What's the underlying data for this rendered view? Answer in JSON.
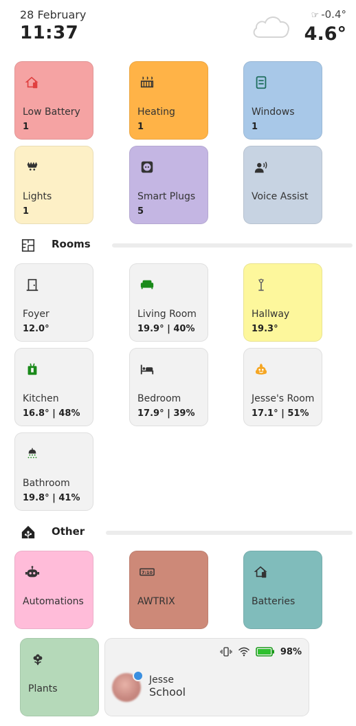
{
  "header": {
    "date": "28 February",
    "time": "11:37",
    "weather_icon": "cloud-icon",
    "temp_low": "-0.4°",
    "temp_current": "4.6°"
  },
  "status_tiles": [
    {
      "label": "Low Battery",
      "value": "1",
      "icon": "battery-alert-icon",
      "color": "#f5a3a3"
    },
    {
      "label": "Heating",
      "value": "1",
      "icon": "radiator-icon",
      "color": "#ffb347"
    },
    {
      "label": "Windows",
      "value": "1",
      "icon": "window-icon",
      "color": "#a8c8e8"
    },
    {
      "label": "Lights",
      "value": "1",
      "icon": "ceiling-light-icon",
      "color": "#fdf0c6"
    },
    {
      "label": "Smart Plugs",
      "value": "5",
      "icon": "power-socket-icon",
      "color": "#c4b6e3"
    },
    {
      "label": "Voice Assist",
      "value": "",
      "icon": "voice-assist-icon",
      "color": "#c7d3e2"
    }
  ],
  "rooms_section": {
    "title": "Rooms",
    "icon": "floor-plan-icon"
  },
  "rooms": [
    {
      "label": "Foyer",
      "value": "12.0°",
      "icon": "door-icon",
      "color": "#f2f2f2"
    },
    {
      "label": "Living Room",
      "value": "19.9° | 40%",
      "icon": "sofa-icon",
      "color": "#f2f2f2"
    },
    {
      "label": "Hallway",
      "value": "19.3°",
      "icon": "floor-lamp-icon",
      "color": "#fdf79c"
    },
    {
      "label": "Kitchen",
      "value": "16.8° | 48%",
      "icon": "fridge-icon",
      "color": "#f2f2f2"
    },
    {
      "label": "Bedroom",
      "value": "17.9° | 39%",
      "icon": "bed-icon",
      "color": "#f2f2f2"
    },
    {
      "label": "Jesse's Room",
      "value": "17.1° | 51%",
      "icon": "emoji-icon",
      "color": "#f2f2f2"
    },
    {
      "label": "Bathroom",
      "value": "19.8° | 41%",
      "icon": "shower-icon",
      "color": "#f2f2f2"
    }
  ],
  "other_section": {
    "title": "Other",
    "icon": "home-assistant-icon"
  },
  "other": [
    {
      "label": "Automations",
      "icon": "robot-icon",
      "color": "#ffbcd9"
    },
    {
      "label": "AWTRIX",
      "icon": "clock-display-icon",
      "color": "#cd8978"
    },
    {
      "label": "Batteries",
      "icon": "home-battery-icon",
      "color": "#80bcbb"
    },
    {
      "label": "Plants",
      "icon": "flower-icon",
      "color": "#b5d9b9"
    }
  ],
  "person": {
    "name": "Jesse",
    "location": "School",
    "battery": "98%",
    "status_icons": [
      "vibrate-icon",
      "wifi-icon",
      "battery-icon"
    ]
  }
}
